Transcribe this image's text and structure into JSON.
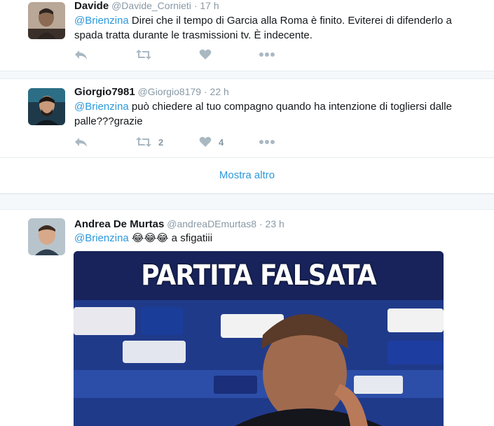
{
  "tweets": [
    {
      "name": "Davide",
      "handle": "@Davide_Cornieti",
      "dot": "·",
      "time": "17 h",
      "mention": "@Brienzina",
      "body": " Direi che il tempo di Garcia alla Roma è finito. Eviterei di difenderlo a spada tratta durante le trasmissioni tv. È indecente.",
      "retweets": "",
      "likes": ""
    },
    {
      "name": "Giorgio7981",
      "handle": "@Giorgio8179",
      "dot": "·",
      "time": "22 h",
      "mention": "@Brienzina",
      "body": " può chiedere al tuo compagno quando ha intenzione di togliersi dalle palle???grazie",
      "retweets": "2",
      "likes": "4"
    },
    {
      "name": "Andrea De Murtas",
      "handle": "@andreaDEmurtas8",
      "dot": "·",
      "time": "23 h",
      "mention": "@Brienzina",
      "body": " 😂😂😂 a sfigatiii",
      "media_caption": "PARTITA FALSATA"
    }
  ],
  "show_more_label": "Mostra altro",
  "colors": {
    "link": "#2b98db",
    "icon": "#aab8c2",
    "meta": "#8899a6",
    "divider": "#e6ecf0"
  },
  "icons": [
    "reply-icon",
    "retweet-icon",
    "like-icon",
    "more-icon"
  ]
}
